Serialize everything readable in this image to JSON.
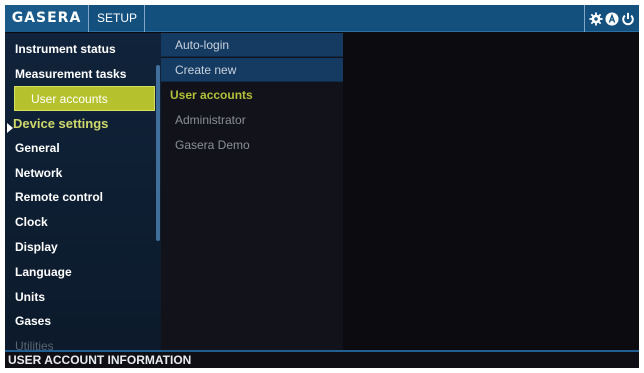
{
  "header": {
    "logo": "GASERA",
    "tab": "SETUP",
    "icons": [
      "gear-icon",
      "user-a-icon",
      "power-icon"
    ]
  },
  "menu": {
    "items": [
      {
        "label": "Instrument status",
        "type": "item"
      },
      {
        "label": "Measurement tasks",
        "type": "item"
      },
      {
        "label": "User accounts",
        "type": "selected"
      },
      {
        "label": "Device settings",
        "type": "section"
      },
      {
        "label": "General",
        "type": "item"
      },
      {
        "label": "Network",
        "type": "item"
      },
      {
        "label": "Remote control",
        "type": "item"
      },
      {
        "label": "Clock",
        "type": "item"
      },
      {
        "label": "Display",
        "type": "item"
      },
      {
        "label": "Language",
        "type": "item"
      },
      {
        "label": "Units",
        "type": "item"
      },
      {
        "label": "Gases",
        "type": "item"
      },
      {
        "label": "Utilities",
        "type": "dim"
      }
    ]
  },
  "submenu": {
    "actions": [
      "Auto-login",
      "Create new"
    ],
    "heading": "User accounts",
    "accounts": [
      "Administrator",
      "Gasera Demo"
    ]
  },
  "footer": {
    "info": "USER ACCOUNT INFORMATION"
  },
  "colors": {
    "topbar": "#14507e",
    "selection": "#b6c22d",
    "section_text": "#cfd86a"
  }
}
